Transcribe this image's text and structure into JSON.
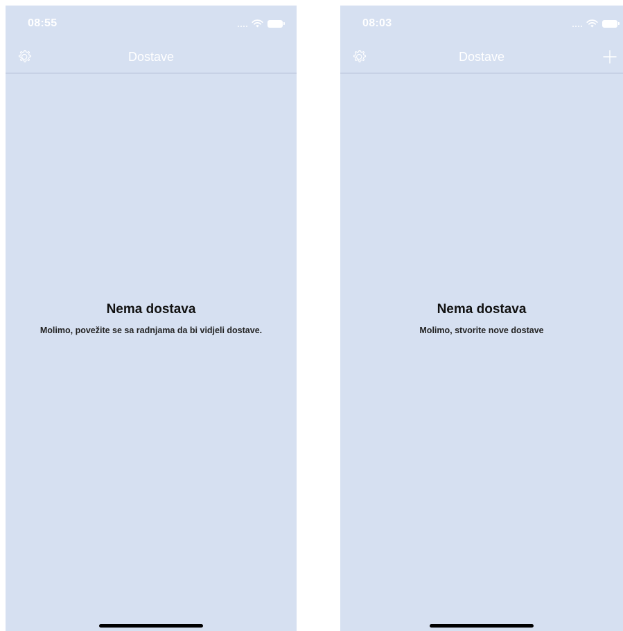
{
  "screens": [
    {
      "status": {
        "time": "08:55",
        "icons": [
          "signal-dots",
          "wifi-icon",
          "battery-icon"
        ]
      },
      "nav": {
        "title": "Dostave",
        "left_icon": "gear-icon",
        "right_icon": null
      },
      "empty_state": {
        "title": "Nema dostava",
        "subtitle": "Molimo, povežite se sa radnjama da bi vidjeli dostave."
      }
    },
    {
      "status": {
        "time": "08:03",
        "icons": [
          "signal-dots",
          "wifi-icon",
          "battery-icon"
        ]
      },
      "nav": {
        "title": "Dostave",
        "left_icon": "gear-icon",
        "right_icon": "plus-icon"
      },
      "empty_state": {
        "title": "Nema dostava",
        "subtitle": "Molimo, stvorite nove dostave"
      }
    }
  ],
  "colors": {
    "screen_background": "#d6e0f1",
    "bar_foreground": "#ffffff",
    "divider": "#aebad2",
    "text_primary": "#111111"
  }
}
